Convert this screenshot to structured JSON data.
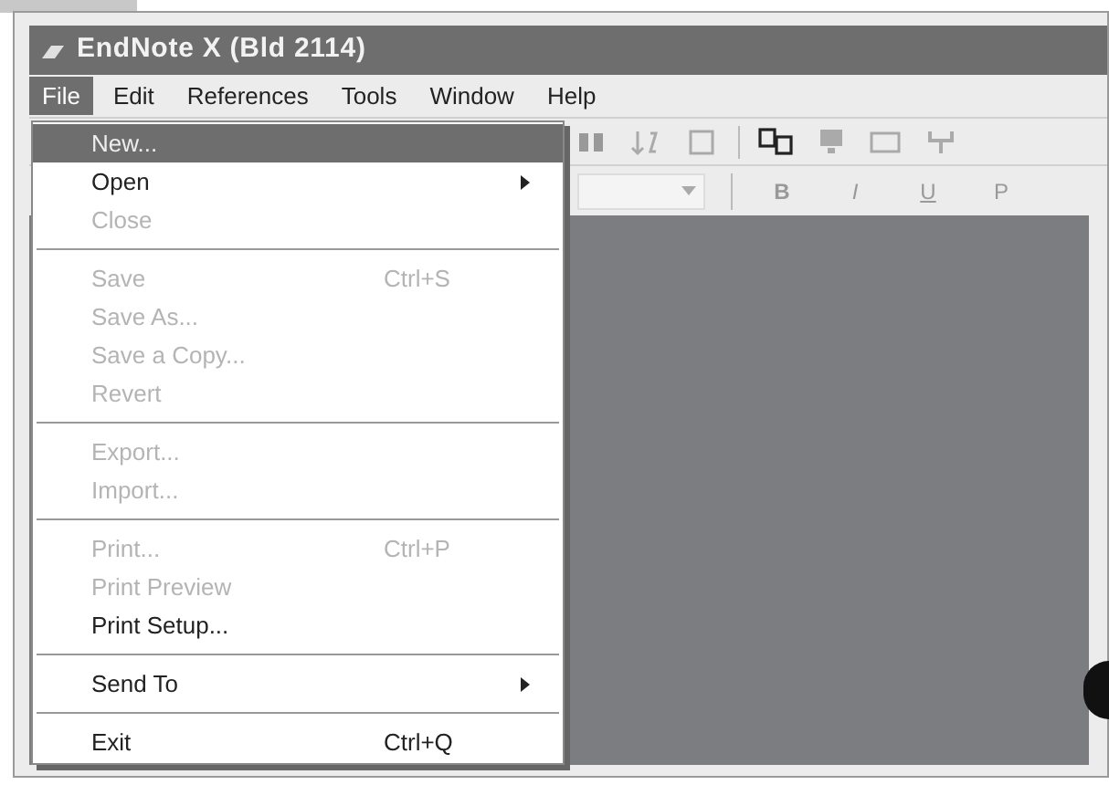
{
  "window": {
    "title": "EndNote X (Bld 2114)"
  },
  "menu_bar": [
    {
      "label": "File",
      "selected": true
    },
    {
      "label": "Edit",
      "selected": false
    },
    {
      "label": "References",
      "selected": false
    },
    {
      "label": "Tools",
      "selected": false
    },
    {
      "label": "Window",
      "selected": false
    },
    {
      "label": "Help",
      "selected": false
    }
  ],
  "format_buttons": [
    "B",
    "I",
    "U",
    "P"
  ],
  "file_menu": [
    {
      "kind": "item",
      "label": "New...",
      "selected": true,
      "disabled": false
    },
    {
      "kind": "item",
      "label": "Open",
      "selected": false,
      "disabled": false,
      "submenu": true
    },
    {
      "kind": "item",
      "label": "Close",
      "selected": false,
      "disabled": true
    },
    {
      "kind": "separator"
    },
    {
      "kind": "item",
      "label": "Save",
      "shortcut": "Ctrl+S",
      "selected": false,
      "disabled": true
    },
    {
      "kind": "item",
      "label": "Save As...",
      "selected": false,
      "disabled": true
    },
    {
      "kind": "item",
      "label": "Save a Copy...",
      "selected": false,
      "disabled": true
    },
    {
      "kind": "item",
      "label": "Revert",
      "selected": false,
      "disabled": true
    },
    {
      "kind": "separator"
    },
    {
      "kind": "item",
      "label": "Export...",
      "selected": false,
      "disabled": true
    },
    {
      "kind": "item",
      "label": "Import...",
      "selected": false,
      "disabled": true
    },
    {
      "kind": "separator"
    },
    {
      "kind": "item",
      "label": "Print...",
      "shortcut": "Ctrl+P",
      "selected": false,
      "disabled": true
    },
    {
      "kind": "item",
      "label": "Print Preview",
      "selected": false,
      "disabled": true
    },
    {
      "kind": "item",
      "label": "Print Setup...",
      "selected": false,
      "disabled": false
    },
    {
      "kind": "separator"
    },
    {
      "kind": "item",
      "label": "Send To",
      "selected": false,
      "disabled": false,
      "submenu": true
    },
    {
      "kind": "separator"
    },
    {
      "kind": "item",
      "label": "Exit",
      "shortcut": "Ctrl+Q",
      "selected": false,
      "disabled": false
    }
  ]
}
